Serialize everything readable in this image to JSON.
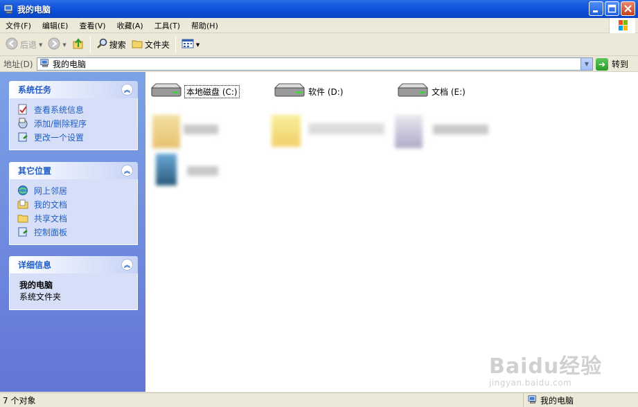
{
  "window": {
    "title": "我的电脑",
    "colors": {
      "titlebar": "#0a4fd6",
      "sidepane": "#6f8fdf",
      "link": "#215dc6"
    }
  },
  "menubar": {
    "items": [
      "文件(F)",
      "编辑(E)",
      "查看(V)",
      "收藏(A)",
      "工具(T)",
      "帮助(H)"
    ]
  },
  "toolbar": {
    "back_label": "后退",
    "search_label": "搜索",
    "folders_label": "文件夹"
  },
  "address": {
    "label": "地址(D)",
    "value": "我的电脑",
    "goto_label": "转到"
  },
  "sidebar": {
    "system_tasks": {
      "title": "系统任务",
      "items": [
        "查看系统信息",
        "添加/删除程序",
        "更改一个设置"
      ]
    },
    "other_places": {
      "title": "其它位置",
      "items": [
        "网上邻居",
        "我的文档",
        "共享文档",
        "控制面板"
      ]
    },
    "details": {
      "title": "详细信息",
      "name": "我的电脑",
      "subtitle": "系统文件夹"
    }
  },
  "drives": [
    {
      "label": "本地磁盘 (C:)",
      "icon": "hard-drive-icon"
    },
    {
      "label": "软件 (D:)",
      "icon": "hard-drive-icon"
    },
    {
      "label": "文档 (E:)",
      "icon": "hard-drive-icon"
    }
  ],
  "status": {
    "count": "7 个对象",
    "location": "我的电脑"
  },
  "watermark": {
    "brand": "Baidu经验",
    "url": "jingyan.baidu.com"
  }
}
